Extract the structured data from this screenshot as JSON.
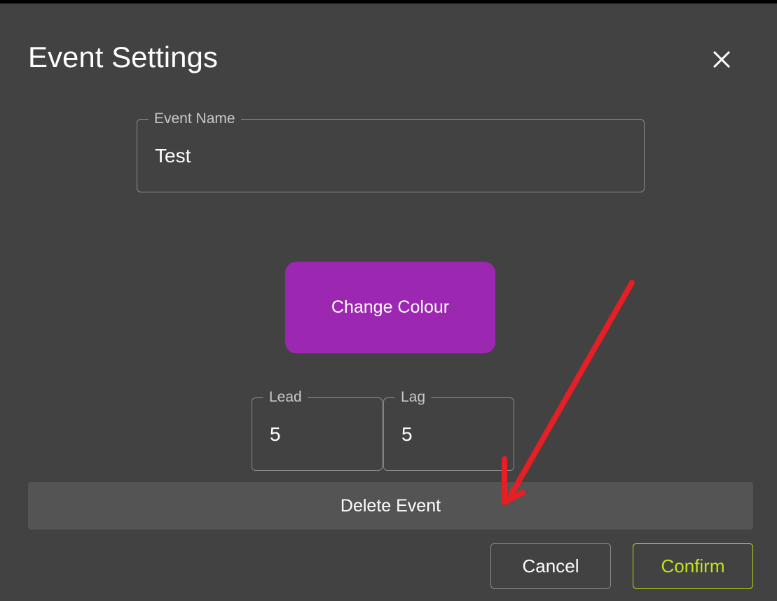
{
  "dialog": {
    "title": "Event Settings",
    "close_icon": "close-icon"
  },
  "event_name": {
    "label": "Event Name",
    "value": "Test"
  },
  "change_colour": {
    "label": "Change Colour",
    "color": "#9c27b0"
  },
  "lead": {
    "label": "Lead",
    "value": "5"
  },
  "lag": {
    "label": "Lag",
    "value": "5"
  },
  "delete_event": {
    "label": "Delete Event"
  },
  "actions": {
    "cancel_label": "Cancel",
    "confirm_label": "Confirm",
    "confirm_color": "#c4e31b"
  },
  "annotation": {
    "arrow_color": "#e61e25"
  }
}
